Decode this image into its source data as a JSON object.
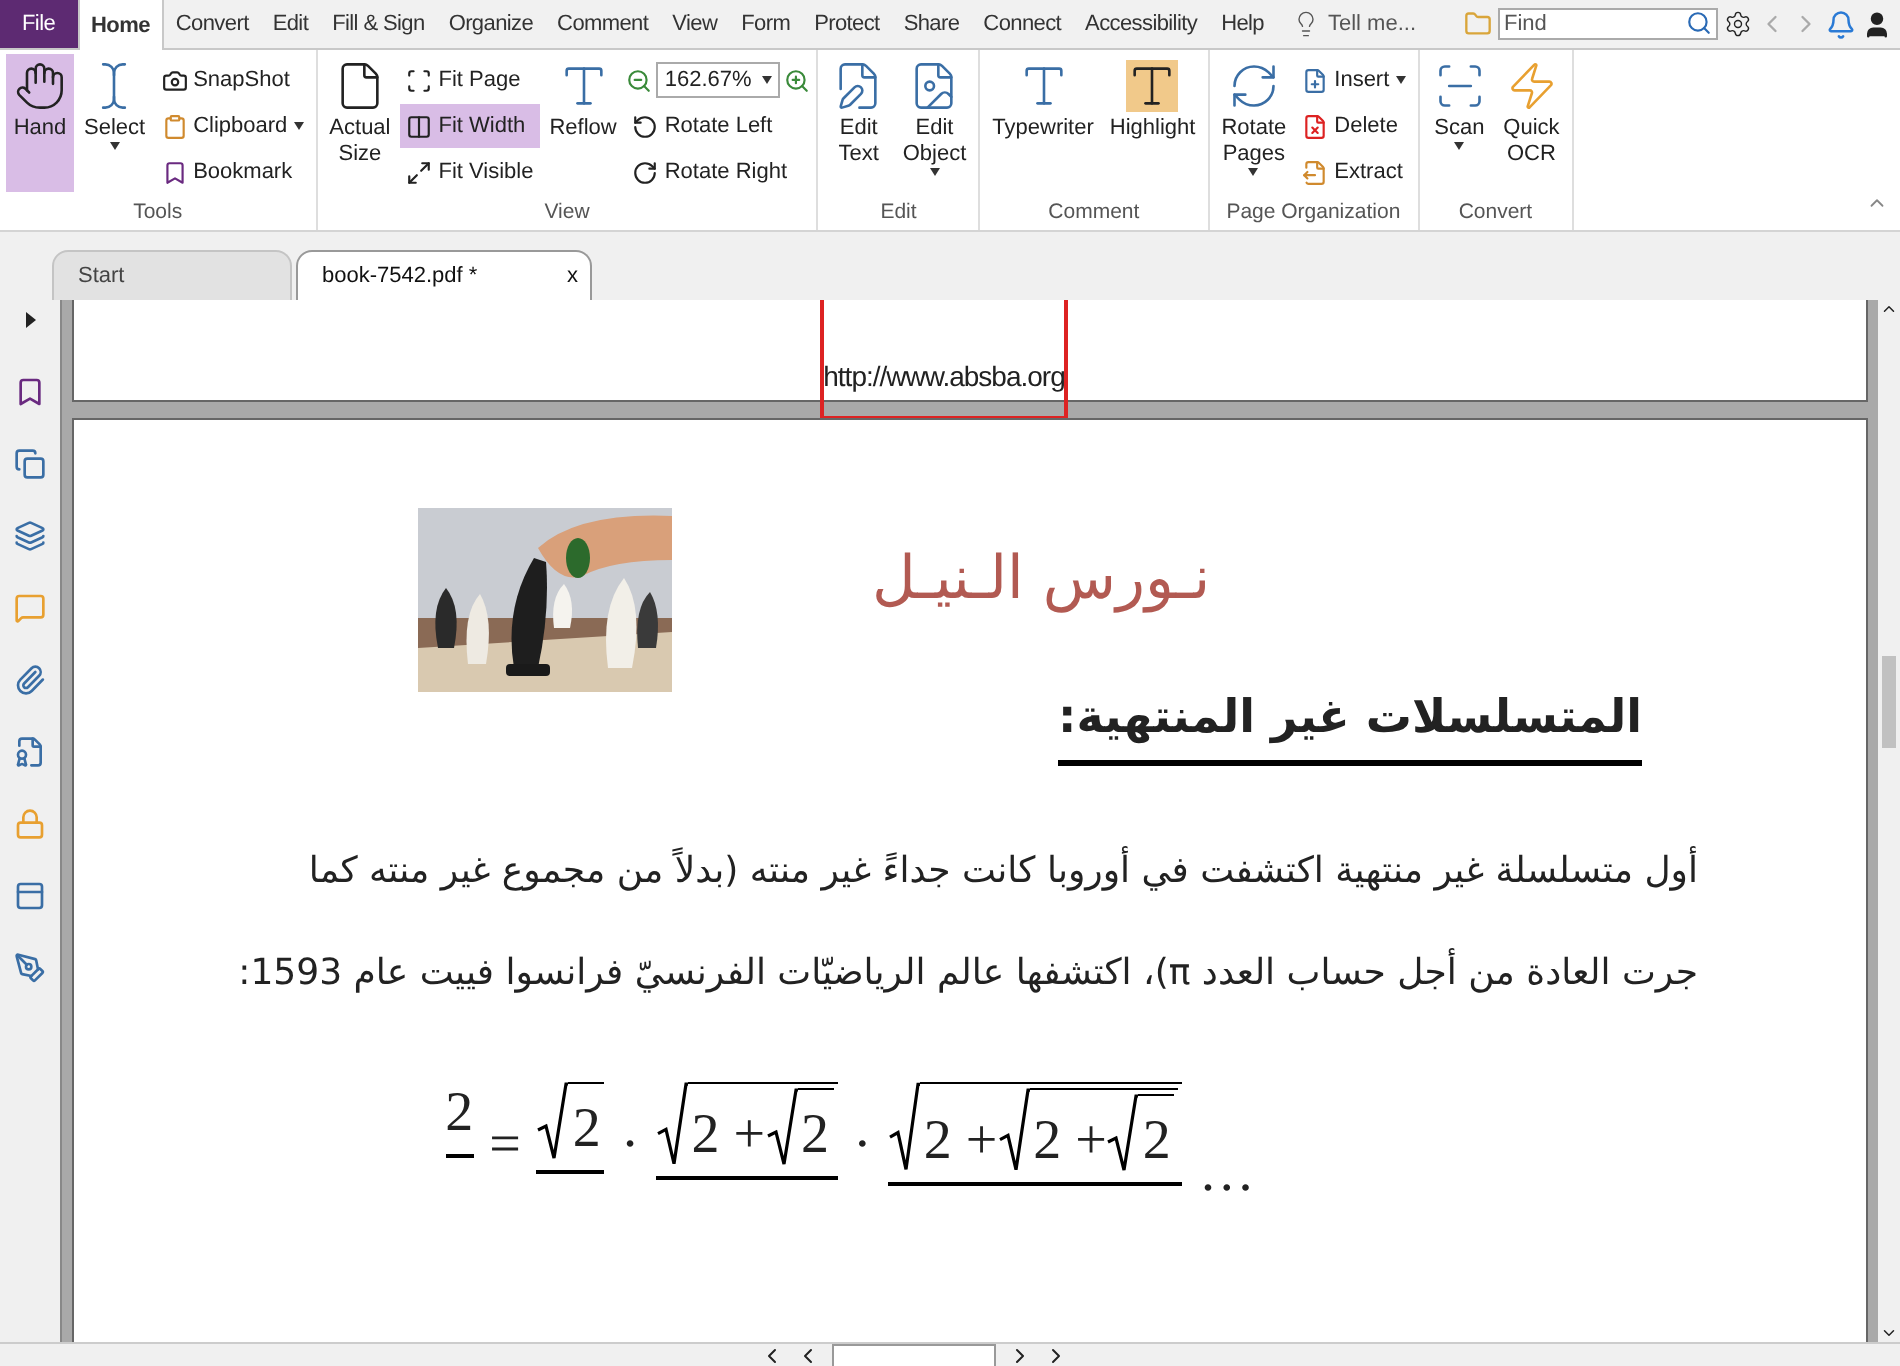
{
  "menu_tabs": [
    {
      "label": "File",
      "kind": "file",
      "selected": false
    },
    {
      "label": "Home",
      "kind": "tab",
      "selected": true
    },
    {
      "label": "Convert",
      "kind": "tab",
      "selected": false
    },
    {
      "label": "Edit",
      "kind": "tab",
      "selected": false
    },
    {
      "label": "Fill & Sign",
      "kind": "tab",
      "selected": false
    },
    {
      "label": "Organize",
      "kind": "tab",
      "selected": false
    },
    {
      "label": "Comment",
      "kind": "tab",
      "selected": false
    },
    {
      "label": "View",
      "kind": "tab",
      "selected": false
    },
    {
      "label": "Form",
      "kind": "tab",
      "selected": false
    },
    {
      "label": "Protect",
      "kind": "tab",
      "selected": false
    },
    {
      "label": "Share",
      "kind": "tab",
      "selected": false
    },
    {
      "label": "Connect",
      "kind": "tab",
      "selected": false
    },
    {
      "label": "Accessibility",
      "kind": "tab",
      "selected": false
    },
    {
      "label": "Help",
      "kind": "tab",
      "selected": false
    }
  ],
  "tell_me": "Tell me...",
  "find": {
    "placeholder": "Find"
  },
  "ribbon_groups": [
    {
      "label": "Tools",
      "items": [
        {
          "kind": "large",
          "label": "Hand",
          "selected": true
        },
        {
          "kind": "large",
          "label": "Select",
          "selected": false,
          "dropdown": true
        },
        {
          "kind": "stack",
          "items": [
            {
              "kind": "small",
              "label": "SnapShot",
              "selected": false
            },
            {
              "kind": "small",
              "label": "Clipboard",
              "selected": false,
              "dropdown": true
            },
            {
              "kind": "small",
              "label": "Bookmark",
              "selected": false
            }
          ]
        }
      ]
    },
    {
      "label": "View",
      "items": [
        {
          "kind": "large",
          "label": "Actual Size",
          "selected": false
        },
        {
          "kind": "stack",
          "items": [
            {
              "kind": "small",
              "label": "Fit Page",
              "selected": false
            },
            {
              "kind": "small",
              "label": "Fit Width",
              "selected": true
            },
            {
              "kind": "small",
              "label": "Fit Visible",
              "selected": false
            }
          ]
        },
        {
          "kind": "large",
          "label": "Reflow",
          "selected": false
        },
        {
          "kind": "stack",
          "items": [
            {
              "kind": "zoom",
              "value": "162.67%"
            },
            {
              "kind": "small",
              "label": "Rotate Left",
              "selected": false
            },
            {
              "kind": "small",
              "label": "Rotate Right",
              "selected": false
            }
          ]
        }
      ]
    },
    {
      "label": "Edit",
      "items": [
        {
          "kind": "large",
          "label": "Edit Text",
          "selected": false
        },
        {
          "kind": "large",
          "label": "Edit Object",
          "selected": false,
          "dropdown": true
        }
      ]
    },
    {
      "label": "Comment",
      "items": [
        {
          "kind": "large",
          "label": "Typewriter",
          "selected": false
        },
        {
          "kind": "large",
          "label": "Highlight",
          "selected": false
        }
      ]
    },
    {
      "label": "Page Organization",
      "items": [
        {
          "kind": "large",
          "label": "Rotate Pages",
          "selected": false,
          "dropdown": true
        },
        {
          "kind": "stack",
          "items": [
            {
              "kind": "small",
              "label": "Insert",
              "selected": false,
              "dropdown": true
            },
            {
              "kind": "small",
              "label": "Delete",
              "selected": false
            },
            {
              "kind": "small",
              "label": "Extract",
              "selected": false
            }
          ]
        }
      ]
    },
    {
      "label": "Convert",
      "items": [
        {
          "kind": "large",
          "label": "Scan",
          "selected": false,
          "dropdown": true
        },
        {
          "kind": "large",
          "label": "Quick OCR",
          "selected": false
        }
      ]
    }
  ],
  "doc_tabs": [
    {
      "label": "Start",
      "selected": false
    },
    {
      "label": "book-7542.pdf *",
      "selected": true,
      "close": "x"
    }
  ],
  "document": {
    "previous_page": {
      "url": "http://www.absba.org"
    },
    "page": {
      "picture": {
        "kind": "picture"
      },
      "title": "نـورس الـنيـل",
      "heading": "المتسلسلات غير المنتهية:",
      "paragraph_lines": [
        "أول متسلسلة غير منتهية اكتشفت في أوروبا كانت جداءً غير منته (بدلاً من مجموع غير منته كما",
        "جرت العادة من أجل حساب العدد π)، اكتشفها عالم الرياضيّات الفرنسيّ فرانسوا فييت عام 1593:"
      ],
      "formula": {
        "lhs": "2",
        "equals": "=",
        "separator": "·",
        "ellipsis": "…",
        "factors": [
          {
            "kind": "sqrt",
            "children": [
              {
                "kind": "text",
                "text": "2"
              }
            ]
          },
          {
            "kind": "sqrt",
            "children": [
              {
                "kind": "text",
                "text": "2 + "
              },
              {
                "kind": "sqrt",
                "children": [
                  {
                    "kind": "text",
                    "text": "2"
                  }
                ]
              }
            ]
          },
          {
            "kind": "sqrt",
            "children": [
              {
                "kind": "text",
                "text": "2 + "
              },
              {
                "kind": "sqrt",
                "children": [
                  {
                    "kind": "text",
                    "text": "2 + "
                  },
                  {
                    "kind": "sqrt",
                    "children": [
                      {
                        "kind": "text",
                        "text": "2"
                      }
                    ]
                  }
                ]
              }
            ]
          }
        ]
      }
    }
  }
}
